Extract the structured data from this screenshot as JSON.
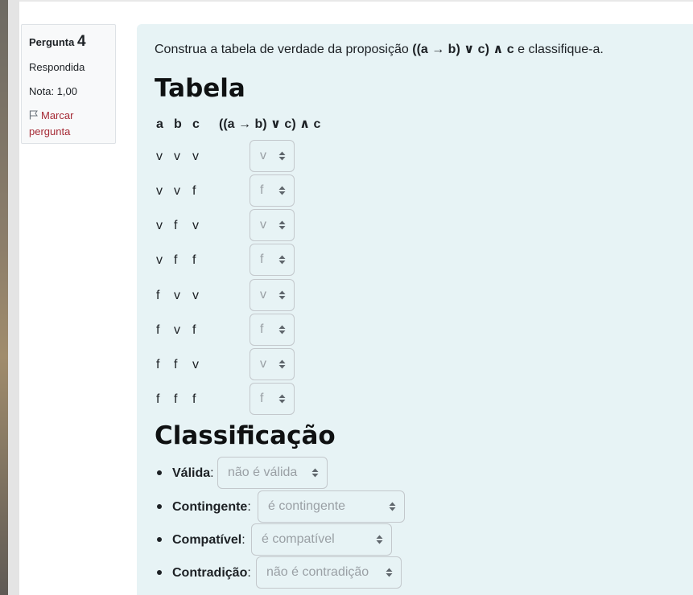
{
  "info": {
    "question_prefix": "Pergunta",
    "question_number": "4",
    "status": "Respondida",
    "grade": "Nota: 1,00",
    "flag_label_line1": "Marcar",
    "flag_label_line2": "pergunta"
  },
  "prompt": {
    "before": "Construa a tabela de verdade da proposição",
    "formula": "((a → b) ∨ c) ∧ c",
    "after": "e classifique-a."
  },
  "table_heading": "Tabela",
  "table": {
    "headers": [
      "a",
      "b",
      "c",
      "((a → b) ∨ c) ∧ c"
    ],
    "rows": [
      {
        "a": "v",
        "b": "v",
        "c": "v",
        "result": "v"
      },
      {
        "a": "v",
        "b": "v",
        "c": "f",
        "result": "f"
      },
      {
        "a": "v",
        "b": "f",
        "c": "v",
        "result": "v"
      },
      {
        "a": "v",
        "b": "f",
        "c": "f",
        "result": "f"
      },
      {
        "a": "f",
        "b": "v",
        "c": "v",
        "result": "v"
      },
      {
        "a": "f",
        "b": "v",
        "c": "f",
        "result": "f"
      },
      {
        "a": "f",
        "b": "f",
        "c": "v",
        "result": "v"
      },
      {
        "a": "f",
        "b": "f",
        "c": "f",
        "result": "f"
      }
    ]
  },
  "classification_heading": "Classificação",
  "classification": [
    {
      "label": "Válida",
      "value": "não é válida"
    },
    {
      "label": "Contingente",
      "value": "é contingente"
    },
    {
      "label": "Compatível",
      "value": "é compatível"
    },
    {
      "label": "Contradição",
      "value": "não é contradição"
    }
  ],
  "colors": {
    "panel_bg": "#e7f3f5",
    "flag_link": "#a52a35",
    "select_text": "#9aa0a5"
  }
}
